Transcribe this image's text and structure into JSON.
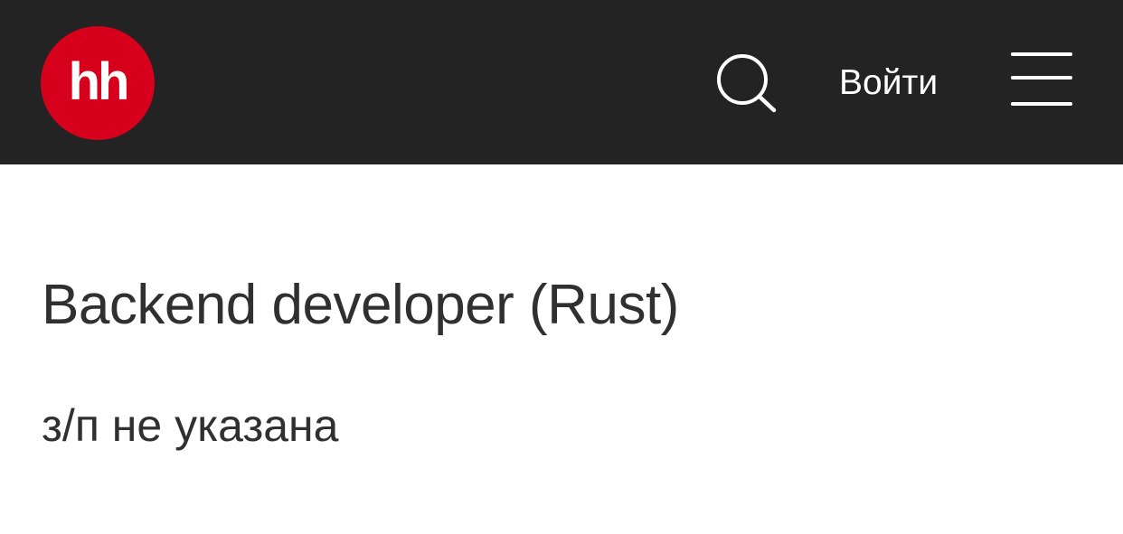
{
  "header": {
    "logo_text": "hh",
    "search_icon": "search-icon",
    "login_label": "Войти",
    "menu_icon": "hamburger-menu-icon",
    "background_color": "#232323",
    "logo_color": "#d6001c"
  },
  "vacancy": {
    "title": "Backend developer (Rust)",
    "salary": "з/п не указана"
  }
}
